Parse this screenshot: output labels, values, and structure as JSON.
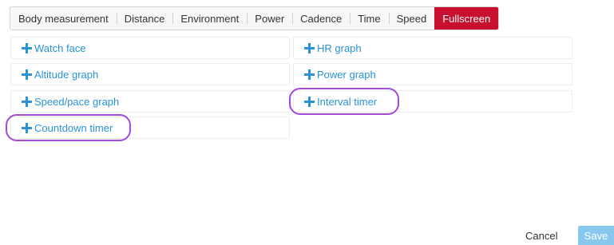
{
  "tabs": [
    {
      "label": "Body measurement",
      "active": false
    },
    {
      "label": "Distance",
      "active": false
    },
    {
      "label": "Environment",
      "active": false
    },
    {
      "label": "Power",
      "active": false
    },
    {
      "label": "Cadence",
      "active": false
    },
    {
      "label": "Time",
      "active": false
    },
    {
      "label": "Speed",
      "active": false
    },
    {
      "label": "Fullscreen",
      "active": true
    }
  ],
  "items": {
    "watch_face": "Watch face",
    "hr_graph": "HR graph",
    "altitude_graph": "Altitude graph",
    "power_graph": "Power graph",
    "speed_pace_graph": "Speed/pace graph",
    "interval_timer": "Interval timer",
    "countdown_timer": "Countdown timer"
  },
  "icons": {
    "add": "plus-icon"
  },
  "colors": {
    "accent_active_tab": "#c8102e",
    "link_blue": "#2a93d5",
    "highlight_ring": "#a24bd6",
    "save_button": "#88c7ee"
  },
  "footer": {
    "cancel_label": "Cancel",
    "save_label": "Save"
  }
}
